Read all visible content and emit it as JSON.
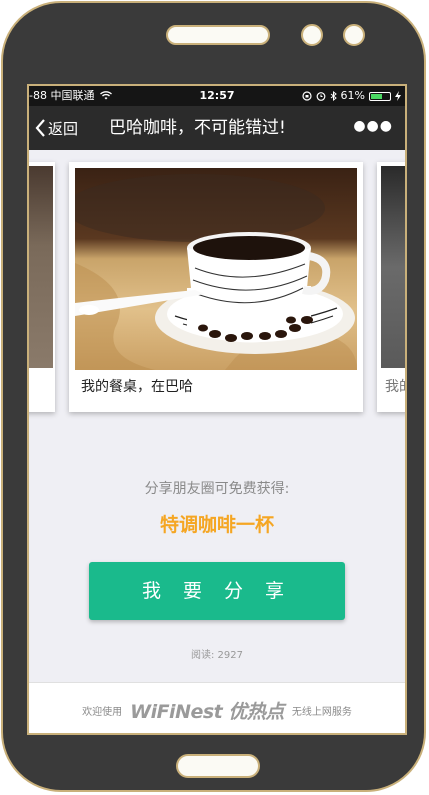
{
  "status_bar": {
    "carrier": "-88 中国联通",
    "time": "12:57",
    "battery_percent": "61%",
    "battery_level": 0.61
  },
  "nav": {
    "back_label": "返回",
    "title": "巴哈咖啡，不可能错过!",
    "more_icon": "more-dots-icon"
  },
  "carousel": {
    "main_caption": "我的餐桌，在巴哈",
    "right_caption_partial": "我的"
  },
  "promo": {
    "share_tip": "分享朋友圈可免费获得:",
    "offer": "特调咖啡一杯",
    "share_button_label": "我 要 分 享",
    "reads_label": "阅读:  2927"
  },
  "footer": {
    "welcome": "欢迎使用",
    "brand": "WiFiNest 优热点",
    "tagline": "无线上网服务"
  },
  "colors": {
    "accent_green": "#1aba8c",
    "offer_orange": "#f5a623",
    "phone_frame": "#3a3a3a",
    "frame_gold": "#c9b07a"
  }
}
